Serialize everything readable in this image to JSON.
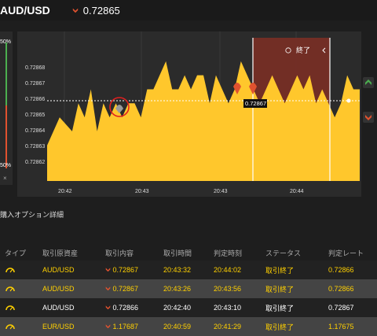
{
  "header": {
    "pair": "AUD/USD",
    "price": "0.72865",
    "direction_icon": "chevron-down-icon"
  },
  "gauge": {
    "top_label": "50%",
    "bottom_label": "50%",
    "close_label": "×",
    "colors": {
      "up": "#4caf50",
      "down": "#e0522f"
    }
  },
  "chart_data": {
    "type": "area",
    "yticks": [
      "0.72868",
      "0.72867",
      "0.72866",
      "0.72865",
      "0.72864",
      "0.72863",
      "0.72862"
    ],
    "xticks": [
      "20:42",
      "20:43",
      "20:43",
      "20:44"
    ],
    "ylim": [
      0.72861,
      0.72869
    ],
    "current_line": 0.72866,
    "current_label": "0.72867",
    "color": "#ffc72c",
    "background": "#2b2b2b",
    "x": [
      0,
      4,
      8,
      10,
      12,
      14,
      16,
      18,
      20,
      22,
      24,
      26,
      28,
      30,
      32,
      34,
      36,
      38,
      40,
      42,
      44,
      46,
      48,
      50,
      52,
      54,
      56,
      58,
      60,
      62,
      64,
      66,
      68,
      70,
      72,
      74,
      76,
      78,
      80,
      82,
      84,
      86,
      88,
      90,
      92,
      94,
      96,
      98,
      100
    ],
    "values": [
      0.72862,
      0.72864,
      0.72863,
      0.72865,
      0.72864,
      0.72866,
      0.72863,
      0.72865,
      0.72864,
      0.72865,
      0.72864,
      0.72865,
      0.72865,
      0.72864,
      0.72866,
      0.72866,
      0.72867,
      0.72868,
      0.72866,
      0.72866,
      0.72867,
      0.72866,
      0.72867,
      0.72867,
      0.72865,
      0.72867,
      0.72866,
      0.72865,
      0.72866,
      0.72868,
      0.72867,
      0.72866,
      0.72865,
      0.72866,
      0.72867,
      0.72866,
      0.72865,
      0.72866,
      0.72867,
      0.72866,
      0.72867,
      0.72865,
      0.72866,
      0.72865,
      0.72864,
      0.72865,
      0.72867,
      0.72866,
      0.72866
    ],
    "grid": true,
    "legend": "none"
  },
  "expiry_zone": {
    "label": "終了",
    "clock_icon": "clock-icon"
  },
  "section": {
    "title": "購入オプション詳細"
  },
  "table": {
    "headers": [
      "タイプ",
      "取引原資産",
      "取引内容",
      "取引時間",
      "判定時刻",
      "ステータス",
      "判定レート"
    ],
    "rows": [
      {
        "type_icon": "gauge-icon",
        "asset": "AUD/USD",
        "content": "0.72867",
        "time": "20:43:32",
        "judge": "20:44:02",
        "status": "取引終了",
        "rate": "0.72866",
        "highlight": "yellow",
        "dir": "down"
      },
      {
        "type_icon": "gauge-icon",
        "asset": "AUD/USD",
        "content": "0.72867",
        "time": "20:43:26",
        "judge": "20:43:56",
        "status": "取引終了",
        "rate": "0.72866",
        "highlight": "yellow",
        "dir": "down"
      },
      {
        "type_icon": "gauge-icon",
        "asset": "AUD/USD",
        "content": "0.72866",
        "time": "20:42:40",
        "judge": "20:43:10",
        "status": "取引終了",
        "rate": "0.72867",
        "highlight": "white",
        "dir": "down"
      },
      {
        "type_icon": "gauge-icon",
        "asset": "EUR/USD",
        "content": "1.17687",
        "time": "20:40:59",
        "judge": "20:41:29",
        "status": "取引終了",
        "rate": "1.17675",
        "highlight": "yellow",
        "dir": "down"
      }
    ]
  }
}
